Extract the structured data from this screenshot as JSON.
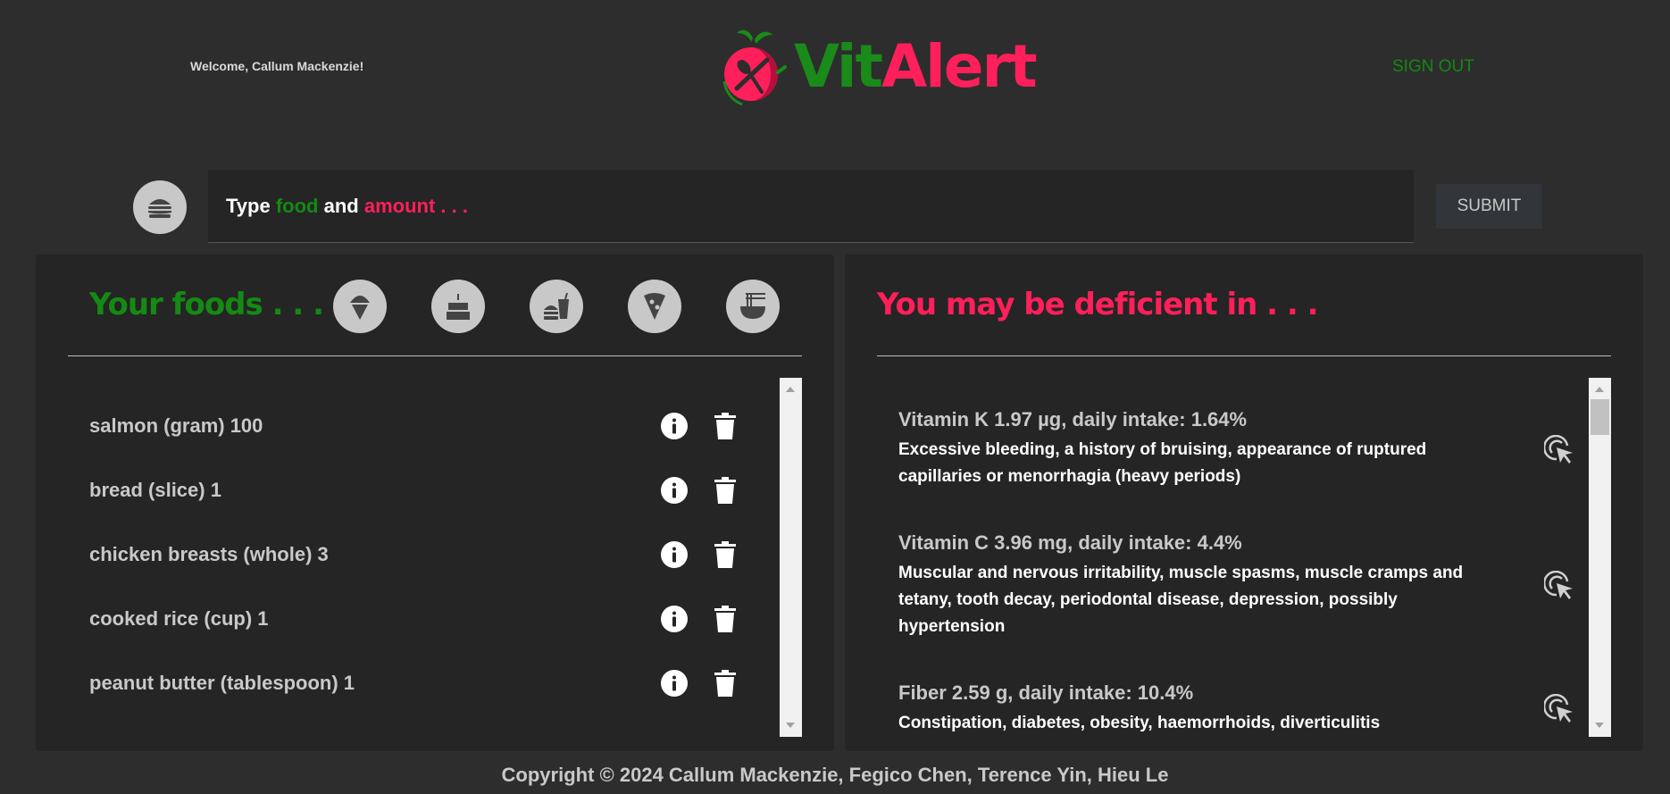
{
  "header": {
    "welcome": "Welcome, Callum Mackenzie!",
    "logo_vit": "Vit",
    "logo_alert": "Alert",
    "signout": "SIGN OUT"
  },
  "search": {
    "placeholder_type": "Type ",
    "placeholder_food": "food",
    "placeholder_and": " and ",
    "placeholder_amount": "amount . . .",
    "submit_label": "SUBMIT"
  },
  "foods_panel": {
    "title": "Your foods . . .",
    "categories": [
      "ice-cream-icon",
      "cake-icon",
      "fast-food-icon",
      "pizza-icon",
      "noodle-bowl-icon"
    ],
    "items": [
      "salmon (gram) 100",
      "bread (slice) 1",
      "chicken breasts (whole) 3",
      "cooked rice (cup) 1",
      "peanut butter (tablespoon) 1"
    ]
  },
  "deficiency_panel": {
    "title": "You may be deficient in . . .",
    "items": [
      {
        "name": "Vitamin K 1.97 µg, daily intake: 1.64%",
        "symptoms": "Excessive bleeding, a history of bruising, appearance of ruptured capillaries or menorrhagia (heavy periods)"
      },
      {
        "name": "Vitamin C 3.96 mg, daily intake: 4.4%",
        "symptoms": "Muscular and nervous irritability, muscle spasms, muscle cramps and tetany, tooth decay, periodontal disease, depression, possibly hypertension"
      },
      {
        "name": "Fiber 2.59 g, daily intake: 10.4%",
        "symptoms": "Constipation, diabetes, obesity, haemorrhoids, diverticulitis"
      }
    ]
  },
  "footer": {
    "copyright": "Copyright © 2024 Callum Mackenzie, Fegico Chen, Terence Yin, Hieu Le"
  },
  "colors": {
    "accent_green": "#138a13",
    "accent_pink": "#ff1f5a",
    "background": "#2d2d2d",
    "panel": "#252525"
  }
}
